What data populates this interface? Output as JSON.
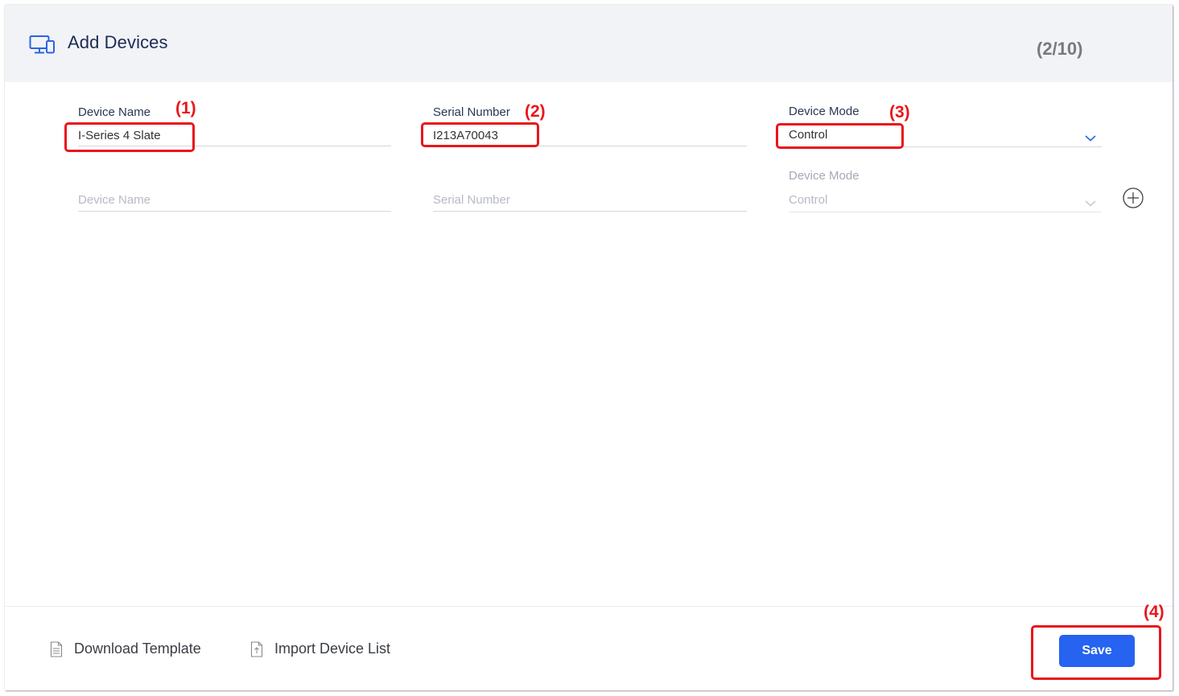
{
  "header": {
    "title": "Add Devices",
    "icon": "devices-icon",
    "counter": "(2/10)"
  },
  "rows": [
    {
      "device_name": {
        "label": "Device Name",
        "value": "I-Series 4 Slate"
      },
      "serial_number": {
        "label": "Serial Number",
        "value": "I213A70043"
      },
      "device_mode": {
        "label": "Device Mode",
        "value": "Control"
      }
    },
    {
      "device_name": {
        "placeholder": "Device Name"
      },
      "serial_number": {
        "placeholder": "Serial Number"
      },
      "device_mode": {
        "label": "Device Mode",
        "value": "Control"
      }
    }
  ],
  "annotations": [
    "(1)",
    "(2)",
    "(3)",
    "(4)"
  ],
  "footer": {
    "download_template": "Download Template",
    "import_device_list": "Import Device List",
    "save": "Save"
  },
  "colors": {
    "accent": "#2563f0",
    "title": "#1d2b55",
    "annotation": "#e8161b",
    "header_bg": "#f2f3f6"
  }
}
